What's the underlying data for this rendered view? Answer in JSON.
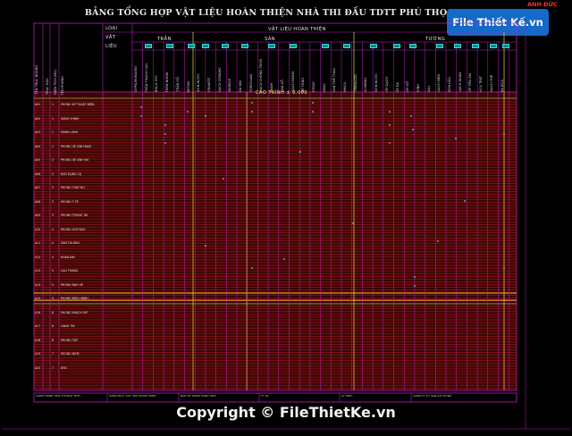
{
  "document": {
    "title": "BẢNG TỔNG HỢP VẬT LIỆU HOÀN THIỆN NHÀ THI ĐẤU TDTT PHÚ THỌ-TPHCM"
  },
  "watermark": {
    "logo_text": "File Thiết Kế.vn",
    "corner_logo": "ANH ĐỨC",
    "copyright": "Copyright © FileThietKe.vn"
  },
  "header": {
    "loai": "LOẠI",
    "vat": "VẬT",
    "lieu": "LIỆU",
    "group_label": "VẬT LIỆU HOÀN THIỆN",
    "groups": [
      "TRẦN",
      "SÀN",
      "TƯỜNG"
    ],
    "left_columns": [
      "TÊN TRỤC NGANG",
      "TRỤC DỌC",
      "DIỆN TÍCH (M2)",
      "TÊN PHÒNG"
    ],
    "elevation_label": "CAO TRÌNH ± 0.000",
    "material_columns": [
      "GYPSUM BOARD",
      "TRẦN THẠCH CAO",
      "NHỰA PVC",
      "TRẦN NHÔM",
      "TRẦN GỖ",
      "BETON",
      "SƠN NƯỚC",
      "GRANITE",
      "GẠCH CERAMIC",
      "MARBLE",
      "ĐÁ MÀI",
      "PORCELAIN",
      "GẠCH CHỐNG TRƠN",
      "THẢM",
      "SÀN GỖ",
      "GẠCH NHÁM",
      "BÊ TÔNG",
      "EPOXY",
      "VINYL",
      "SÀN THỂ THAO",
      "NHỰA",
      "TERRAZZO",
      "XI MĂNG",
      "SƠN NƯỚC",
      "ỐP GẠCH",
      "ỐP ĐÁ",
      "ỐP GỖ",
      "KÍNH",
      "ALU",
      "GẠCH MEN",
      "SƠN DẦU",
      "VÁCH NGĂN",
      "ỐP TIÊU ÂM",
      "VỮA TRÁT",
      "GẠCH THẺ",
      "ĐÁ RỬA"
    ],
    "badge_count": 18
  },
  "table": {
    "rows": [
      {
        "code": "A01",
        "a": "1",
        "room": "PHÒNG KỸ THUẬT ĐIỆN"
      },
      {
        "code": "A02",
        "a": "1",
        "room": "SẢNH CHÍNH"
      },
      {
        "code": "A03",
        "a": "1",
        "room": "HÀNH LANG"
      },
      {
        "code": "A04",
        "a": "2",
        "room": "PHÒNG VỆ SINH NAM"
      },
      {
        "code": "A05",
        "a": "2",
        "room": "PHÒNG VỆ SINH NỮ"
      },
      {
        "code": "A06",
        "a": "2",
        "room": "KHO DỤNG CỤ"
      },
      {
        "code": "A07",
        "a": "3",
        "room": "PHÒNG THAY ĐỒ"
      },
      {
        "code": "A08",
        "a": "3",
        "room": "PHÒNG Y TẾ"
      },
      {
        "code": "A09",
        "a": "3",
        "room": "PHÒNG TRỌNG TÀI"
      },
      {
        "code": "A10",
        "a": "4",
        "room": "PHÒNG HỌP BÁO"
      },
      {
        "code": "A11",
        "a": "4",
        "room": "SÂN THI ĐẤU"
      },
      {
        "code": "A12",
        "a": "4",
        "room": "KHÁN ĐÀI"
      },
      {
        "code": "A13",
        "a": "5",
        "room": "CẦU THANG"
      },
      {
        "code": "A14",
        "a": "5",
        "room": "PHÒNG BẢO VỆ"
      },
      {
        "code": "A15",
        "a": "5",
        "room": "PHÒNG ĐIỀU HÀNH"
      },
      {
        "code": "A16",
        "a": "6",
        "room": "PHÒNG KHÁCH VIP"
      },
      {
        "code": "A17",
        "a": "6",
        "room": "CĂNG TIN"
      },
      {
        "code": "A18",
        "a": "6",
        "room": "PHÒNG TẬP"
      },
      {
        "code": "A19",
        "a": "7",
        "room": "PHÒNG BƠM"
      },
      {
        "code": "A20",
        "a": "7",
        "room": "KHO"
      }
    ]
  },
  "footer": {
    "cells": [
      "CÔNG TRÌNH: NHÀ THI ĐẤU TDTT",
      "HẠNG MỤC: VẬT LIỆU HOÀN THIỆN",
      "BẢN VẼ: BẢNG TỔNG HỢP",
      "TỶ LỆ:",
      "KÝ HIỆU:",
      "CÔNG TY TƯ VẤN XÂY DỰNG"
    ]
  }
}
